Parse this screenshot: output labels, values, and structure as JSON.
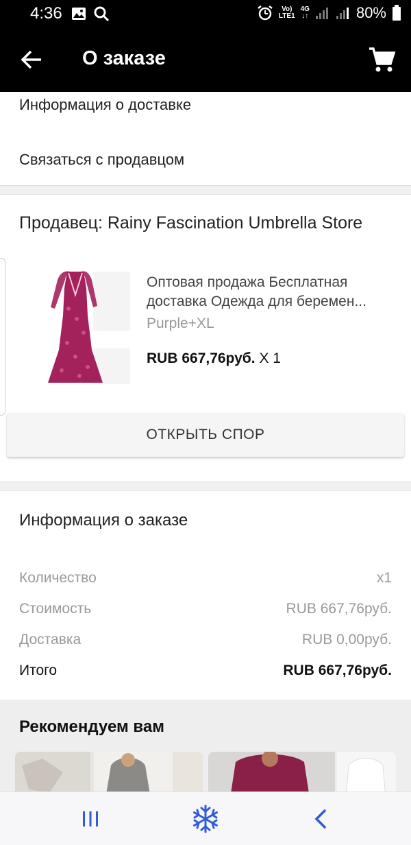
{
  "status_bar": {
    "time": "4:36",
    "network_top": "Vo)",
    "network_bottom": "LTE1",
    "network_type": "4G",
    "battery": "80%",
    "icons": [
      "image-icon",
      "search-icon",
      "alarm-icon",
      "signal-icon",
      "battery-icon"
    ]
  },
  "app_bar": {
    "title": "О заказе",
    "icons": [
      "back-arrow-icon",
      "cart-icon"
    ]
  },
  "links": {
    "delivery_info": "Информация о доставке",
    "contact_seller": "Связаться с продавцом"
  },
  "seller": {
    "label": "Продавец: Rainy Fascination Umbrella Store"
  },
  "product": {
    "title_line1": "Оптовая продажа Бесплатная",
    "title_line2": "доставка Одежда для беремен...",
    "variant": "Purple+XL",
    "price": "RUB 667,76руб.",
    "quantity": "X 1",
    "image_color": "#a4225c"
  },
  "dispute_button": "ОТКРЫТЬ СПОР",
  "order_info": {
    "title": "Информация о заказе",
    "rows": [
      {
        "label": "Количество",
        "value": "x1"
      },
      {
        "label": "Стоимость",
        "value": "RUB 667,76руб."
      },
      {
        "label": "Доставка",
        "value": "RUB 0,00руб."
      }
    ],
    "total": {
      "label": "Итого",
      "value": "RUB 667,76руб."
    }
  },
  "recommend": {
    "title": "Рекомендуем вам"
  },
  "nav_bar": {
    "icons": [
      "recent-apps-icon",
      "snowflake-icon",
      "nav-back-icon"
    ],
    "accent": "#2f5bd8"
  }
}
